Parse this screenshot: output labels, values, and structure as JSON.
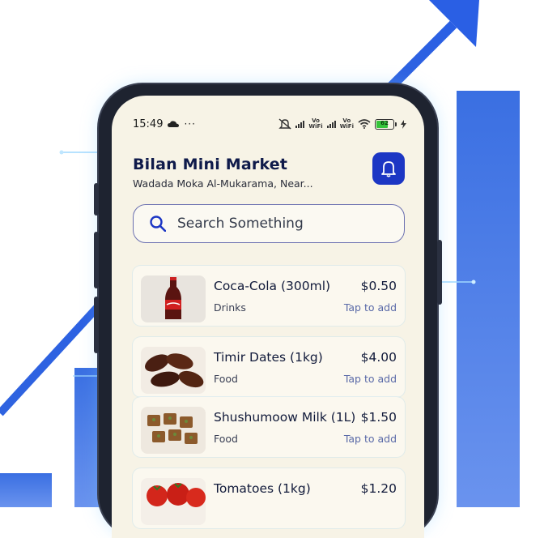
{
  "status_bar": {
    "time": "15:49",
    "left_icons": [
      "cloud-icon",
      "more-dots-icon"
    ],
    "right_icons": [
      "mute-icon",
      "signal-icon",
      "signal-icon",
      "wifi-icon",
      "battery-icon",
      "charging-icon"
    ],
    "volte_label": "Vo\nWiFi",
    "battery_level": "62"
  },
  "header": {
    "title": "Bilan Mini Market",
    "address": "Wadada Moka Al-Mukarama, Near..."
  },
  "search": {
    "placeholder": "Search Something"
  },
  "products": [
    {
      "name": "Coca-Cola (300ml)",
      "price": "$0.50",
      "category": "Drinks",
      "action": "Tap to add",
      "image": "coca-cola-bottle"
    },
    {
      "name": "Timir Dates (1kg)",
      "price": "$4.00",
      "category": "Food",
      "action": "Tap to add",
      "image": "dates"
    },
    {
      "name": "Shushumoow Milk (1L)",
      "price": "$1.50",
      "category": "Food",
      "action": "Tap to add",
      "image": "milk-cubes"
    },
    {
      "name": "Tomatoes (1kg)",
      "price": "$1.20",
      "category": "",
      "action": "",
      "image": "tomatoes"
    }
  ],
  "colors": {
    "accent": "#1c36c4",
    "bars": "#3a6fe2",
    "screen_bg": "#f7f3e6"
  }
}
